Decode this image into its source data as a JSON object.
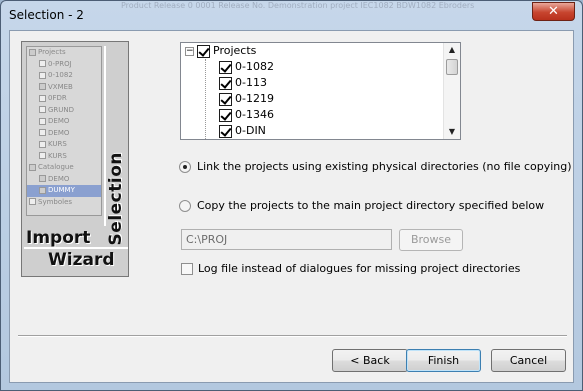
{
  "window": {
    "title": "Selection - 2",
    "close_symbol": "✕",
    "background_title_text": "Product Release 0 0001 Release No.   Demonstration project IEC1082     BDW1082     Ebroders"
  },
  "wizard_image": {
    "tree_items": [
      "Projects",
      "0-PROJ",
      "0-1082",
      "VXMEB",
      "0FDR",
      "GRUND",
      "DEMO",
      "DEMO",
      "KURS",
      "KURS",
      "Catalogue",
      "DEMO",
      "DUMMY",
      "Symboles"
    ],
    "selection_text": "Selection",
    "import_text": "Import",
    "wizard_text": "Wizard"
  },
  "tree": {
    "root": {
      "label": "Projects",
      "expander": "−",
      "checked": true
    },
    "children": [
      {
        "label": "0-1082",
        "checked": true
      },
      {
        "label": "0-113",
        "checked": true
      },
      {
        "label": "0-1219",
        "checked": true
      },
      {
        "label": "0-1346",
        "checked": true
      },
      {
        "label": "0-DIN",
        "checked": true
      }
    ],
    "scroll_up": "▲",
    "scroll_down": "▼"
  },
  "options": {
    "link_label": "Link the projects using existing physical directories (no file copying)",
    "link_selected": true,
    "copy_label": "Copy the projects to the main project directory specified below",
    "copy_selected": false,
    "path_value": "C:\\PROJ",
    "browse_label": "Browse",
    "logfile_label": "Log file instead of dialogues for missing project directories",
    "logfile_checked": false
  },
  "buttons": {
    "back_label": "< Back",
    "finish_label": "Finish",
    "cancel_label": "Cancel"
  }
}
